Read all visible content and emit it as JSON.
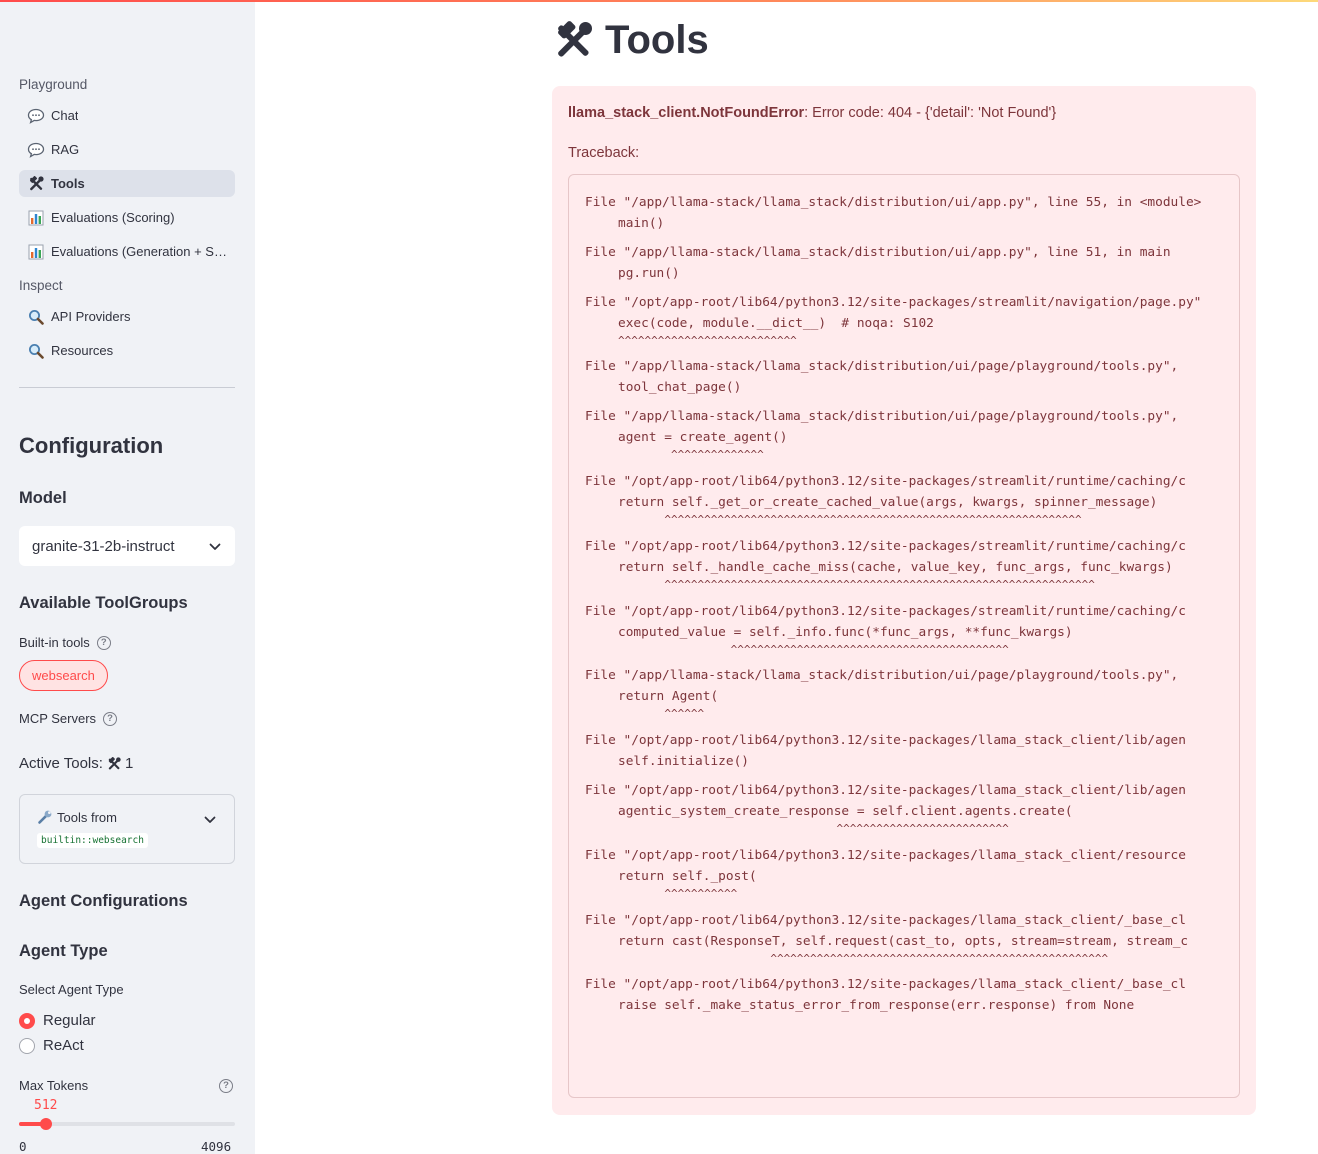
{
  "sidebar": {
    "nav": {
      "playground_header": "Playground",
      "playground_items": [
        {
          "label": "Chat",
          "icon": "speech-balloon-icon"
        },
        {
          "label": "RAG",
          "icon": "speech-balloon-icon"
        },
        {
          "label": "Tools",
          "icon": "hammer-wrench-icon",
          "active": true
        },
        {
          "label": "Evaluations (Scoring)",
          "icon": "bar-chart-icon"
        },
        {
          "label": "Evaluations (Generation + S…",
          "icon": "bar-chart-icon"
        }
      ],
      "inspect_header": "Inspect",
      "inspect_items": [
        {
          "label": "API Providers",
          "icon": "magnifier-icon"
        },
        {
          "label": "Resources",
          "icon": "magnifier-icon"
        }
      ]
    },
    "configuration": {
      "title": "Configuration",
      "model_header": "Model",
      "model_value": "granite-31-2b-instruct",
      "toolgroups_header": "Available ToolGroups",
      "builtin_label": "Built-in tools",
      "builtin_selected": "websearch",
      "mcp_label": "MCP Servers",
      "active_tools_label": "Active Tools:",
      "active_tools_count": "1",
      "expander_title": "Tools from",
      "expander_code": "builtin::websearch",
      "agent_config_header": "Agent Configurations",
      "agent_type_header": "Agent Type",
      "select_agent_label": "Select Agent Type",
      "agent_options": [
        "Regular",
        "ReAct"
      ],
      "agent_selected": "Regular",
      "max_tokens_label": "Max Tokens",
      "max_tokens_value": "512",
      "max_tokens_min": "0",
      "max_tokens_max": "4096",
      "max_tokens_fraction": 0.125
    }
  },
  "main": {
    "title": "Tools",
    "title_icon": "hammer-wrench-icon",
    "error_type": "llama_stack_client.NotFoundError",
    "error_detail": ": Error code: 404 - {'detail': 'Not Found'}",
    "traceback_label": "Traceback:",
    "traceback": [
      {
        "file": "File \"/app/llama-stack/llama_stack/distribution/ui/app.py\", line 55, in <module>",
        "code": "main()",
        "caret": ""
      },
      {
        "file": "File \"/app/llama-stack/llama_stack/distribution/ui/app.py\", line 51, in main",
        "code": "pg.run()",
        "caret": ""
      },
      {
        "file": "File \"/opt/app-root/lib64/python3.12/site-packages/streamlit/navigation/page.py\"",
        "code": "exec(code, module.__dict__)  # noqa: S102",
        "caret": "^^^^^^^^^^^^^^^^^^^^^^^^^^^"
      },
      {
        "file": "File \"/app/llama-stack/llama_stack/distribution/ui/page/playground/tools.py\",",
        "code": "tool_chat_page()",
        "caret": ""
      },
      {
        "file": "File \"/app/llama-stack/llama_stack/distribution/ui/page/playground/tools.py\",",
        "code": "agent = create_agent()",
        "caret": "        ^^^^^^^^^^^^^^"
      },
      {
        "file": "File \"/opt/app-root/lib64/python3.12/site-packages/streamlit/runtime/caching/c",
        "code": "return self._get_or_create_cached_value(args, kwargs, spinner_message)",
        "caret": "       ^^^^^^^^^^^^^^^^^^^^^^^^^^^^^^^^^^^^^^^^^^^^^^^^^^^^^^^^^^^^^^^"
      },
      {
        "file": "File \"/opt/app-root/lib64/python3.12/site-packages/streamlit/runtime/caching/c",
        "code": "return self._handle_cache_miss(cache, value_key, func_args, func_kwargs)",
        "caret": "       ^^^^^^^^^^^^^^^^^^^^^^^^^^^^^^^^^^^^^^^^^^^^^^^^^^^^^^^^^^^^^^^^^"
      },
      {
        "file": "File \"/opt/app-root/lib64/python3.12/site-packages/streamlit/runtime/caching/c",
        "code": "computed_value = self._info.func(*func_args, **func_kwargs)",
        "caret": "                 ^^^^^^^^^^^^^^^^^^^^^^^^^^^^^^^^^^^^^^^^^^"
      },
      {
        "file": "File \"/app/llama-stack/llama_stack/distribution/ui/page/playground/tools.py\",",
        "code": "return Agent(",
        "caret": "       ^^^^^^"
      },
      {
        "file": "File \"/opt/app-root/lib64/python3.12/site-packages/llama_stack_client/lib/agen",
        "code": "self.initialize()",
        "caret": ""
      },
      {
        "file": "File \"/opt/app-root/lib64/python3.12/site-packages/llama_stack_client/lib/agen",
        "code": "agentic_system_create_response = self.client.agents.create(",
        "caret": "                                 ^^^^^^^^^^^^^^^^^^^^^^^^^^"
      },
      {
        "file": "File \"/opt/app-root/lib64/python3.12/site-packages/llama_stack_client/resource",
        "code": "return self._post(",
        "caret": "       ^^^^^^^^^^^"
      },
      {
        "file": "File \"/opt/app-root/lib64/python3.12/site-packages/llama_stack_client/_base_cl",
        "code": "return cast(ResponseT, self.request(cast_to, opts, stream=stream, stream_c",
        "caret": "                       ^^^^^^^^^^^^^^^^^^^^^^^^^^^^^^^^^^^^^^^^^^^^^^^^^^^"
      },
      {
        "file": "File \"/opt/app-root/lib64/python3.12/site-packages/llama_stack_client/_base_cl",
        "code": "raise self._make_status_error_from_response(err.response) from None",
        "caret": ""
      }
    ]
  },
  "colors": {
    "accent": "#ff4b4b",
    "sidebar_bg": "#f0f2f6",
    "error_bg": "#ffebed",
    "error_text": "#7d353b"
  }
}
